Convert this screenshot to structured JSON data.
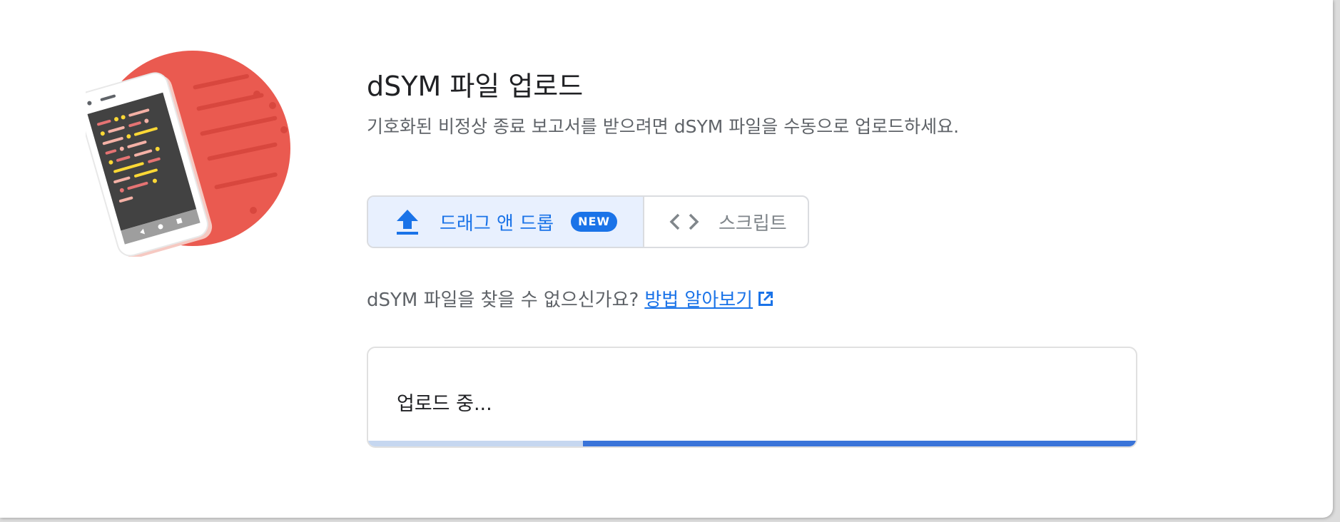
{
  "header": {
    "title": "dSYM 파일 업로드",
    "subtitle": "기호화된 비정상 종료 보고서를 받으려면 dSYM 파일을 수동으로 업로드하세요."
  },
  "toggle": {
    "drag_label": "드래그 앤 드롭",
    "badge": "NEW",
    "script_label": "스크립트",
    "selected": "drag"
  },
  "help": {
    "question": "dSYM 파일을 찾을 수 없으신가요?",
    "link_label": "방법 알아보기"
  },
  "upload": {
    "status": "업로드 중...",
    "progress": 0.72
  },
  "colors": {
    "accent": "#1a73e8",
    "illustration_circle": "#ea5a50",
    "progress_fill": "#3a74d9",
    "progress_track": "#c6d7f0"
  },
  "icons": {
    "upload": "upload-icon",
    "code": "code-icon",
    "external_link": "open-in-new-icon"
  }
}
